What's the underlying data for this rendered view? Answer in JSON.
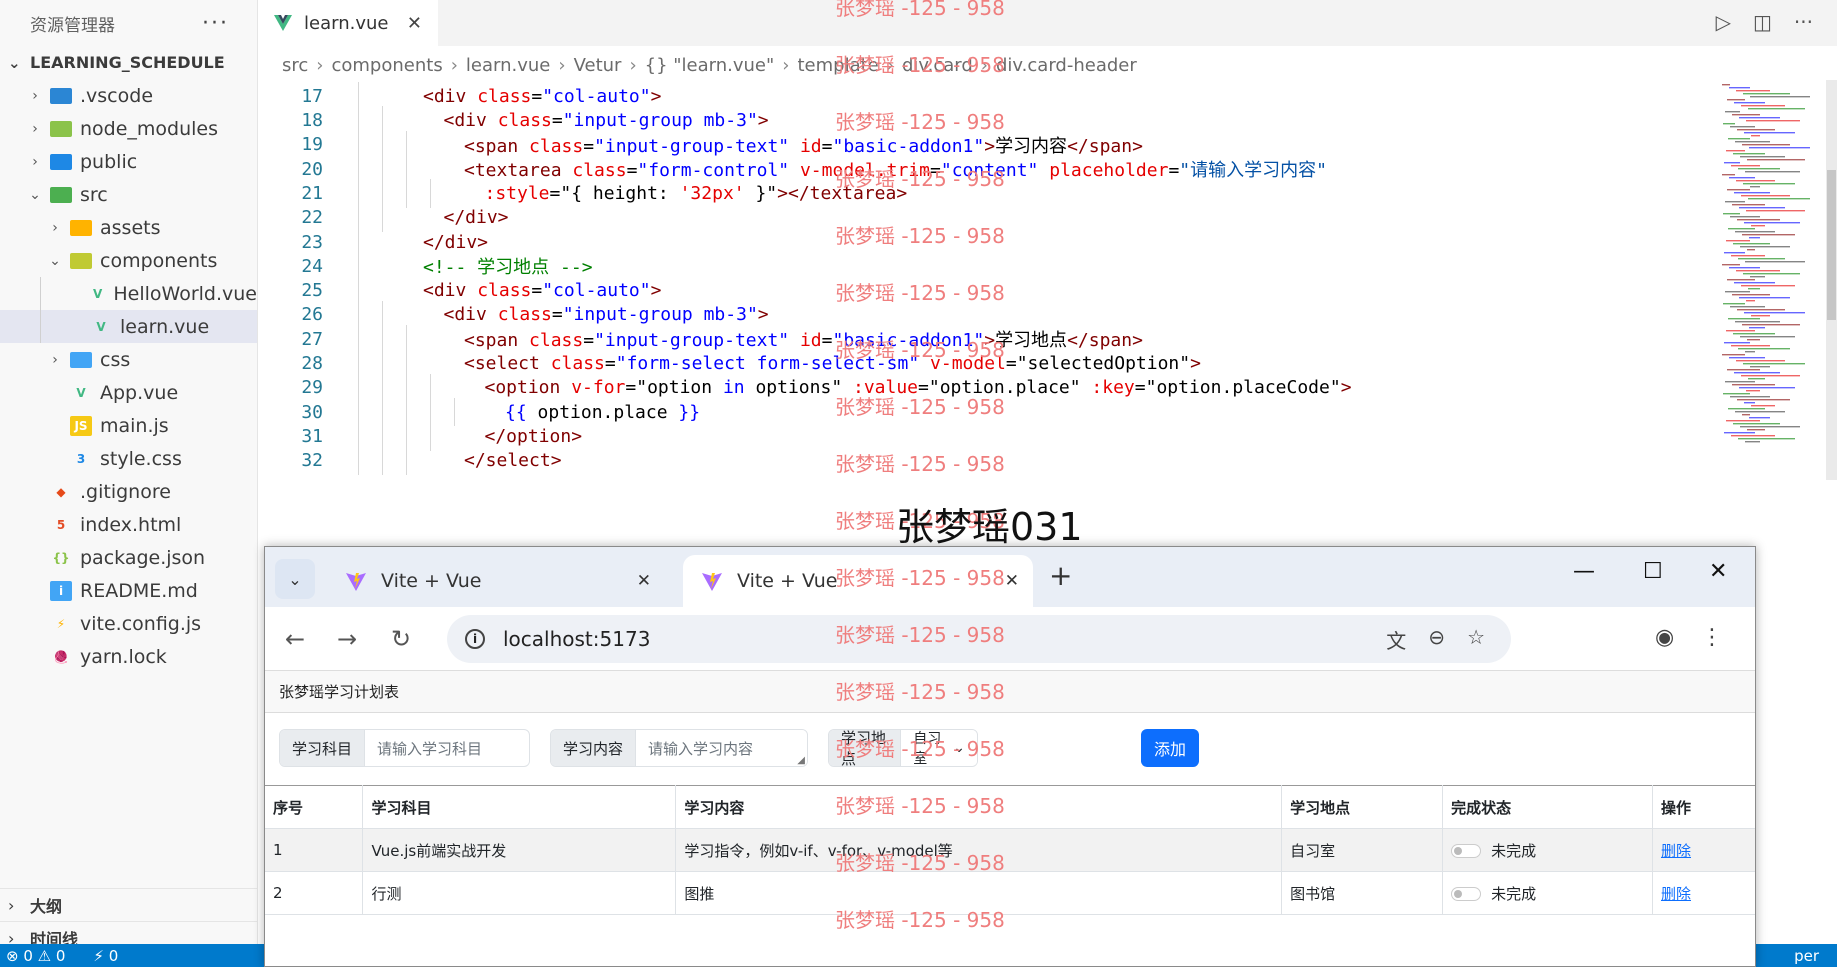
{
  "explorer": {
    "title": "资源管理器",
    "more": "···",
    "project": "LEARNING_SCHEDULE",
    "items": [
      {
        "label": ".vscode",
        "icon": "vscode-folder-icon",
        "chev": "›"
      },
      {
        "label": "node_modules",
        "icon": "node-folder-icon",
        "chev": "›"
      },
      {
        "label": "public",
        "icon": "public-folder-icon",
        "chev": "›"
      },
      {
        "label": "src",
        "icon": "src-folder-icon",
        "chev": "⌄"
      },
      {
        "label": "assets",
        "icon": "assets-folder-icon",
        "chev": "›"
      },
      {
        "label": "components",
        "icon": "components-folder-icon",
        "chev": "⌄"
      },
      {
        "label": "HelloWorld.vue",
        "icon": "vue-file-icon"
      },
      {
        "label": "learn.vue",
        "icon": "vue-file-icon"
      },
      {
        "label": "css",
        "icon": "css-folder-icon",
        "chev": "›"
      },
      {
        "label": "App.vue",
        "icon": "vue-file-icon"
      },
      {
        "label": "main.js",
        "icon": "js-file-icon"
      },
      {
        "label": "style.css",
        "icon": "css-file-icon"
      },
      {
        "label": ".gitignore",
        "icon": "git-file-icon"
      },
      {
        "label": "index.html",
        "icon": "html-file-icon"
      },
      {
        "label": "package.json",
        "icon": "json-file-icon"
      },
      {
        "label": "README.md",
        "icon": "info-file-icon"
      },
      {
        "label": "vite.config.js",
        "icon": "vite-file-icon"
      },
      {
        "label": "yarn.lock",
        "icon": "yarn-file-icon"
      }
    ],
    "outline": "大纲",
    "timeline": "时间线"
  },
  "editor": {
    "tab_label": "learn.vue",
    "tab_close": "✕",
    "breadcrumb": [
      "src",
      "components",
      "learn.vue",
      "Vetur",
      "{} \"learn.vue\"",
      "template",
      "div.card",
      "div.card-header"
    ],
    "line_numbers": [
      "17",
      "18",
      "19",
      "20",
      "21",
      "22",
      "23",
      "24",
      "25",
      "26",
      "27",
      "28",
      "29",
      "30",
      "31",
      "32"
    ]
  },
  "watermark": {
    "text": "张梦瑶 -125 - 958",
    "big": "张梦瑶031"
  },
  "statusbar": {
    "problems": "⊗ 0 ⚠ 0",
    "ports": "⚡ 0",
    "right": "per"
  },
  "browser": {
    "tabs": [
      {
        "label": "Vite + Vue"
      },
      {
        "label": "Vite + Vue"
      }
    ],
    "url": "localhost:5173",
    "page": {
      "header": "张梦瑶学习计划表",
      "subject_label": "学习科目",
      "subject_placeholder": "请输入学习科目",
      "content_label": "学习内容",
      "content_placeholder": "请输入学习内容",
      "place_label": "学习地点",
      "place_selected": "自习室",
      "add_button": "添加",
      "columns": [
        "序号",
        "学习科目",
        "学习内容",
        "学习地点",
        "完成状态",
        "操作"
      ],
      "rows": [
        {
          "id": "1",
          "subject": "Vue.js前端实战开发",
          "content": "学习指令，例如v-if、v-for、v-model等",
          "place": "自习室",
          "status": "未完成",
          "action": "删除"
        },
        {
          "id": "2",
          "subject": "行测",
          "content": "图推",
          "place": "图书馆",
          "status": "未完成",
          "action": "删除"
        }
      ]
    }
  },
  "colors": {
    "vue_green": "#41b883",
    "accent_blue": "#0d6efd",
    "status_blue": "#007acc",
    "watermark_red": "#ef7e7e"
  }
}
